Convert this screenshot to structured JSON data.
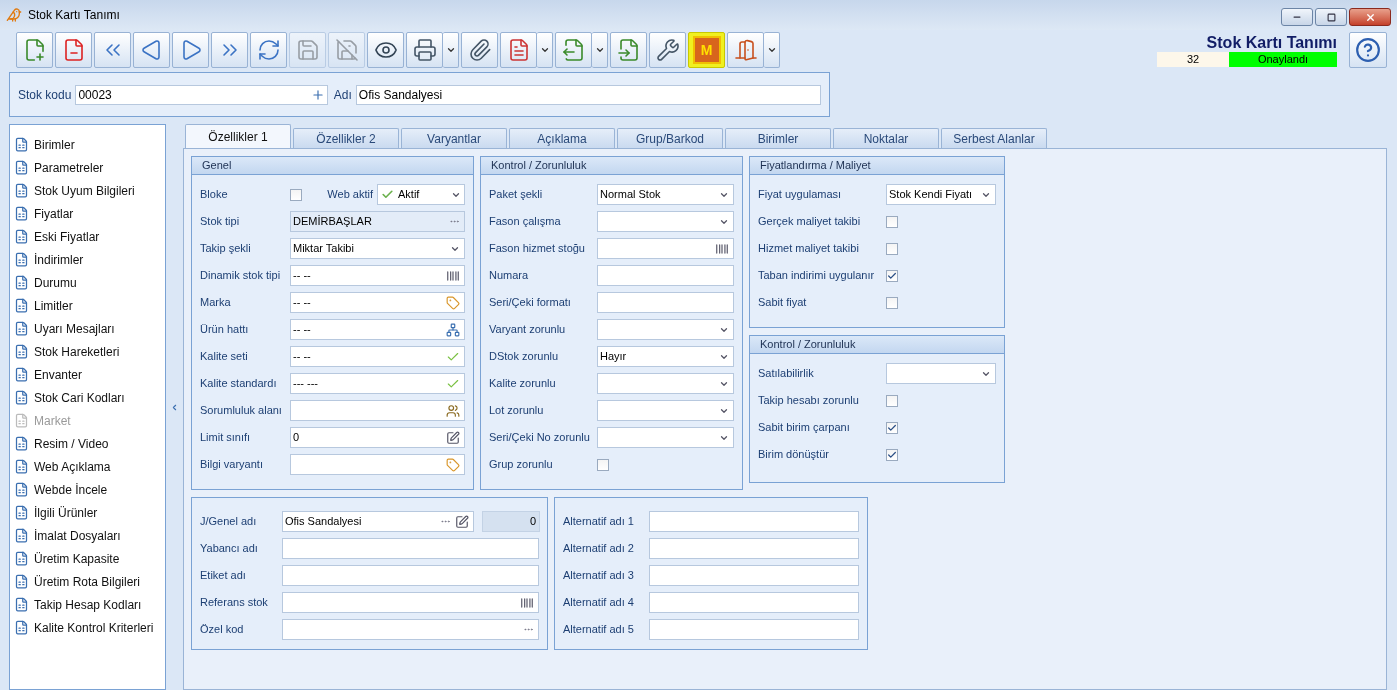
{
  "window": {
    "title": "Stok Kartı Tanımı"
  },
  "toolbar": [
    {
      "kind": "new",
      "disabled": false,
      "menu": false,
      "highlighted": false
    },
    {
      "kind": "delete",
      "disabled": false,
      "menu": false,
      "highlighted": false
    },
    {
      "kind": "first",
      "disabled": false,
      "menu": false,
      "highlighted": false
    },
    {
      "kind": "previous",
      "disabled": false,
      "menu": false,
      "highlighted": false
    },
    {
      "kind": "next",
      "disabled": false,
      "menu": false,
      "highlighted": false
    },
    {
      "kind": "last",
      "disabled": false,
      "menu": false,
      "highlighted": false
    },
    {
      "kind": "refresh",
      "disabled": false,
      "menu": false,
      "highlighted": false
    },
    {
      "kind": "save",
      "disabled": true,
      "menu": false,
      "highlighted": false
    },
    {
      "kind": "discard",
      "disabled": true,
      "menu": false,
      "highlighted": false
    },
    {
      "kind": "preview",
      "disabled": false,
      "menu": false,
      "highlighted": false
    },
    {
      "kind": "print",
      "disabled": false,
      "menu": true,
      "highlighted": false
    },
    {
      "kind": "attach",
      "disabled": false,
      "menu": false,
      "highlighted": false
    },
    {
      "kind": "pdf",
      "disabled": false,
      "menu": true,
      "highlighted": false
    },
    {
      "kind": "export",
      "disabled": false,
      "menu": true,
      "highlighted": false
    },
    {
      "kind": "import",
      "disabled": false,
      "menu": false,
      "highlighted": false
    },
    {
      "kind": "tools",
      "disabled": false,
      "menu": false,
      "highlighted": false
    },
    {
      "kind": "mark",
      "label": "M",
      "disabled": false,
      "menu": false,
      "highlighted": true
    },
    {
      "kind": "exit",
      "disabled": false,
      "menu": true,
      "highlighted": false
    }
  ],
  "header": {
    "title": "Stok Kartı Tanımı",
    "number": "32",
    "status": "Onaylandı"
  },
  "code_bar": {
    "code_label": "Stok kodu",
    "code": "00023",
    "name_label": "Adı",
    "name": "Ofis Sandalyesi"
  },
  "sidebar": {
    "items": [
      {
        "label": "Birimler",
        "disabled": false
      },
      {
        "label": "Parametreler",
        "disabled": false
      },
      {
        "label": "Stok Uyum Bilgileri",
        "disabled": false
      },
      {
        "label": "Fiyatlar",
        "disabled": false
      },
      {
        "label": "Eski Fiyatlar",
        "disabled": false
      },
      {
        "label": "İndirimler",
        "disabled": false
      },
      {
        "label": "Durumu",
        "disabled": false
      },
      {
        "label": "Limitler",
        "disabled": false
      },
      {
        "label": "Uyarı Mesajları",
        "disabled": false
      },
      {
        "label": "Stok Hareketleri",
        "disabled": false
      },
      {
        "label": "Envanter",
        "disabled": false
      },
      {
        "label": "Stok Cari Kodları",
        "disabled": false
      },
      {
        "label": "Market",
        "disabled": true
      },
      {
        "label": "Resim / Video",
        "disabled": false
      },
      {
        "label": "Web Açıklama",
        "disabled": false
      },
      {
        "label": "Webde İncele",
        "disabled": false
      },
      {
        "label": "İlgili Ürünler",
        "disabled": false
      },
      {
        "label": "İmalat Dosyaları",
        "disabled": false
      },
      {
        "label": "Üretim Kapasite",
        "disabled": false
      },
      {
        "label": "Üretim Rota Bilgileri",
        "disabled": false
      },
      {
        "label": "Takip Hesap Kodları",
        "disabled": false
      },
      {
        "label": "Kalite Kontrol Kriterleri",
        "disabled": false
      }
    ]
  },
  "tabs": [
    {
      "label": "Özellikler 1",
      "selected": true
    },
    {
      "label": "Özellikler 2",
      "selected": false
    },
    {
      "label": "Varyantlar",
      "selected": false
    },
    {
      "label": "Açıklama",
      "selected": false
    },
    {
      "label": "Grup/Barkod",
      "selected": false
    },
    {
      "label": "Birimler",
      "selected": false
    },
    {
      "label": "Noktalar",
      "selected": false
    },
    {
      "label": "Serbest Alanlar",
      "selected": false
    }
  ],
  "general": {
    "title": "Genel",
    "rows": [
      {
        "label": "Bloke",
        "kind": "checkbox",
        "checked": false,
        "extra": {
          "label": "Web aktif",
          "value": "Aktif"
        }
      },
      {
        "label": "Stok tipi",
        "kind": "lookup",
        "value": "DEMİRBAŞLAR"
      },
      {
        "label": "Takip şekli",
        "kind": "select",
        "value": "Miktar Takibi"
      },
      {
        "label": "Dinamik stok tipi",
        "kind": "barcode",
        "value": "-- --"
      },
      {
        "label": "Marka",
        "kind": "tag",
        "value": "-- --"
      },
      {
        "label": "Ürün hattı",
        "kind": "tree",
        "value": "-- --"
      },
      {
        "label": "Kalite seti",
        "kind": "check",
        "value": "-- --"
      },
      {
        "label": "Kalite standardı",
        "kind": "check",
        "value": "--- ---"
      },
      {
        "label": "Sorumluluk alanı",
        "kind": "people"
      },
      {
        "label": "Limit sınıfı",
        "kind": "note",
        "value": "0"
      },
      {
        "label": "Bilgi varyantı",
        "kind": "tag"
      }
    ]
  },
  "control": {
    "title": "Kontrol / Zorunluluk",
    "rows": [
      {
        "label": "Paket şekli",
        "kind": "select",
        "value": "Normal Stok"
      },
      {
        "label": "Fason çalışma",
        "kind": "select"
      },
      {
        "label": "Fason hizmet stoğu",
        "kind": "barcode"
      },
      {
        "label": "Numara",
        "kind": "text"
      },
      {
        "label": "Seri/Çeki formatı",
        "kind": "text"
      },
      {
        "label": "Varyant zorunlu",
        "kind": "select"
      },
      {
        "label": "DStok zorunlu",
        "kind": "select",
        "value": "Hayır"
      },
      {
        "label": "Kalite zorunlu",
        "kind": "select"
      },
      {
        "label": "Lot zorunlu",
        "kind": "select"
      },
      {
        "label": "Seri/Çeki No zorunlu",
        "kind": "select"
      },
      {
        "label": "Grup zorunlu",
        "kind": "checkbox",
        "checked": false
      }
    ]
  },
  "pricing": {
    "title": "Fiyatlandırma / Maliyet",
    "rows": [
      {
        "label": "Fiyat uygulaması",
        "kind": "select",
        "value": "Stok Kendi Fiyatı"
      },
      {
        "label": "Gerçek maliyet takibi",
        "kind": "checkbox",
        "checked": false
      },
      {
        "label": "Hizmet maliyet takibi",
        "kind": "checkbox",
        "checked": false
      },
      {
        "label": "Taban indirimi uygulanır",
        "kind": "checkbox",
        "checked": true
      },
      {
        "label": "Sabit fiyat",
        "kind": "checkbox",
        "checked": false
      }
    ]
  },
  "control_2": {
    "title": "Kontrol / Zorunluluk",
    "rows": [
      {
        "label": "Satılabilirlik",
        "kind": "select"
      },
      {
        "label": "Takip hesabı zorunlu",
        "kind": "checkbox",
        "checked": false
      },
      {
        "label": "Sabit birim çarpanı",
        "kind": "checkbox",
        "checked": true
      },
      {
        "label": "Birim dönüştür",
        "kind": "checkbox",
        "checked": true
      }
    ]
  },
  "names": {
    "rows": [
      {
        "label": "J/Genel adı",
        "kind": "name_edit",
        "value": "Ofis Sandalyesi",
        "count": "0"
      },
      {
        "label": "Yabancı adı",
        "kind": "text"
      },
      {
        "label": "Etiket adı",
        "kind": "text"
      },
      {
        "label": "Referans stok",
        "kind": "barcode"
      },
      {
        "label": "Özel kod",
        "kind": "ellipsis"
      }
    ]
  },
  "alternative_names": {
    "rows": [
      {
        "label": "Alternatif adı 1",
        "kind": "text"
      },
      {
        "label": "Alternatif adı 2",
        "kind": "text"
      },
      {
        "label": "Alternatif adı 3",
        "kind": "text"
      },
      {
        "label": "Alternatif adı 4",
        "kind": "text"
      },
      {
        "label": "Alternatif adı 5",
        "kind": "text"
      }
    ]
  }
}
